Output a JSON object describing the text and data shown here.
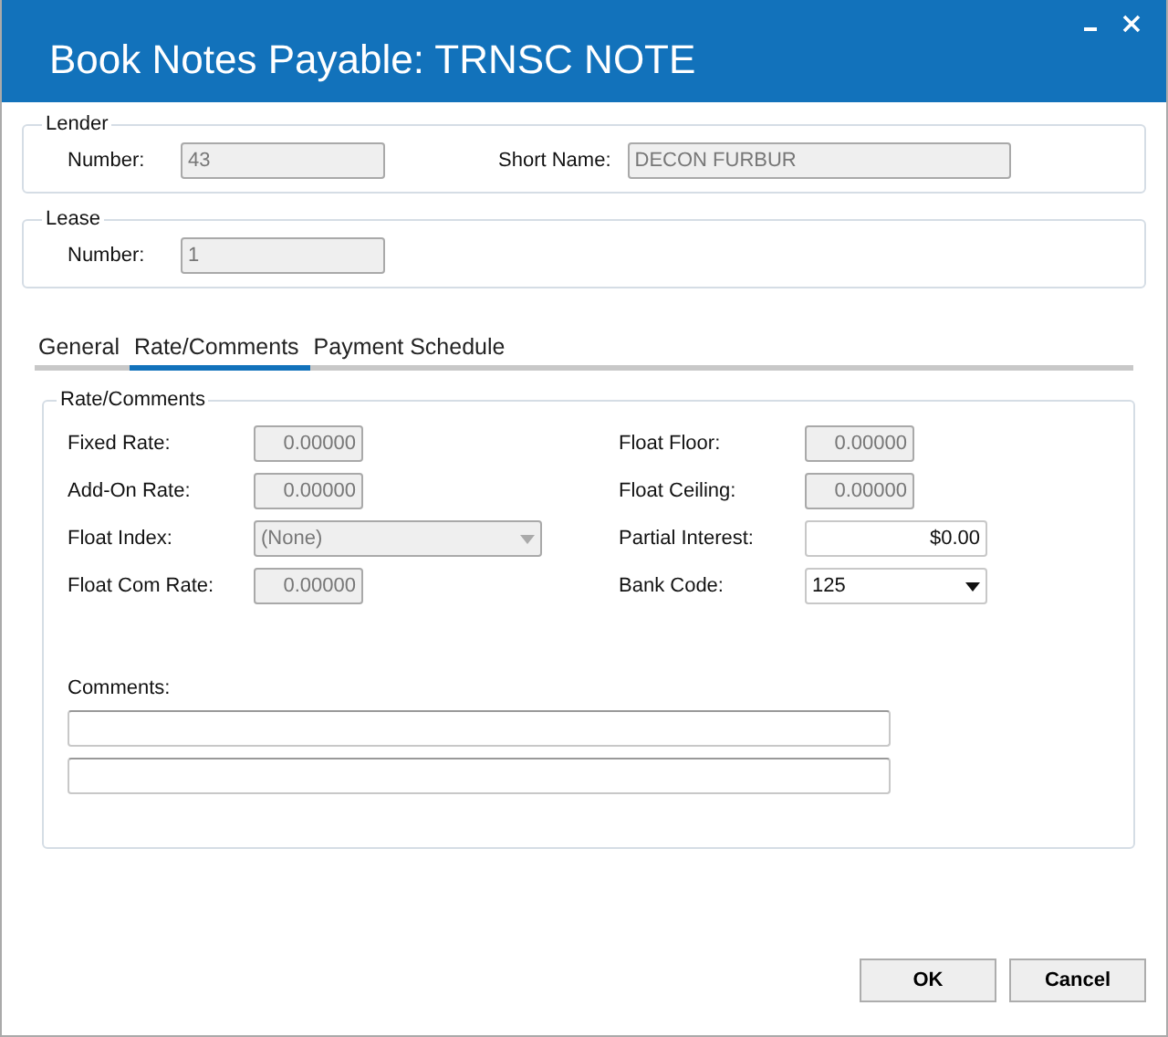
{
  "window": {
    "title": "Book Notes Payable: TRNSC NOTE"
  },
  "lender": {
    "legend": "Lender",
    "fields": [
      {
        "label": "Number:",
        "value": "43",
        "disabled": true
      },
      {
        "label": "Short Name:",
        "value": "DECON FURBUR",
        "disabled": true
      }
    ]
  },
  "lease": {
    "legend": "Lease",
    "fields": [
      {
        "label": "Number:",
        "value": "1",
        "disabled": true
      }
    ]
  },
  "tabs": [
    {
      "label": "General",
      "selected": false
    },
    {
      "label": "Rate/Comments",
      "selected": true
    },
    {
      "label": "Payment Schedule",
      "selected": false
    }
  ],
  "rate_comments": {
    "legend": "Rate/Comments",
    "left": [
      {
        "label": "Fixed Rate:",
        "value": "0.00000",
        "disabled": true,
        "kind": "number"
      },
      {
        "label": "Add-On Rate:",
        "value": "0.00000",
        "disabled": true,
        "kind": "number"
      },
      {
        "label": "Float Index:",
        "value": "(None)",
        "disabled": true,
        "kind": "dropdown"
      },
      {
        "label": "Float Com Rate:",
        "value": "0.00000",
        "disabled": true,
        "kind": "number"
      }
    ],
    "right": [
      {
        "label": "Float Floor:",
        "value": "0.00000",
        "disabled": true,
        "kind": "number"
      },
      {
        "label": "Float Ceiling:",
        "value": "0.00000",
        "disabled": true,
        "kind": "number"
      },
      {
        "label": "Partial Interest:",
        "value": "$0.00",
        "disabled": false,
        "kind": "money"
      },
      {
        "label": "Bank Code:",
        "value": "125",
        "disabled": false,
        "kind": "dropdown"
      }
    ],
    "comments_label": "Comments:"
  },
  "buttons": [
    {
      "label": "OK"
    },
    {
      "label": "Cancel"
    }
  ]
}
